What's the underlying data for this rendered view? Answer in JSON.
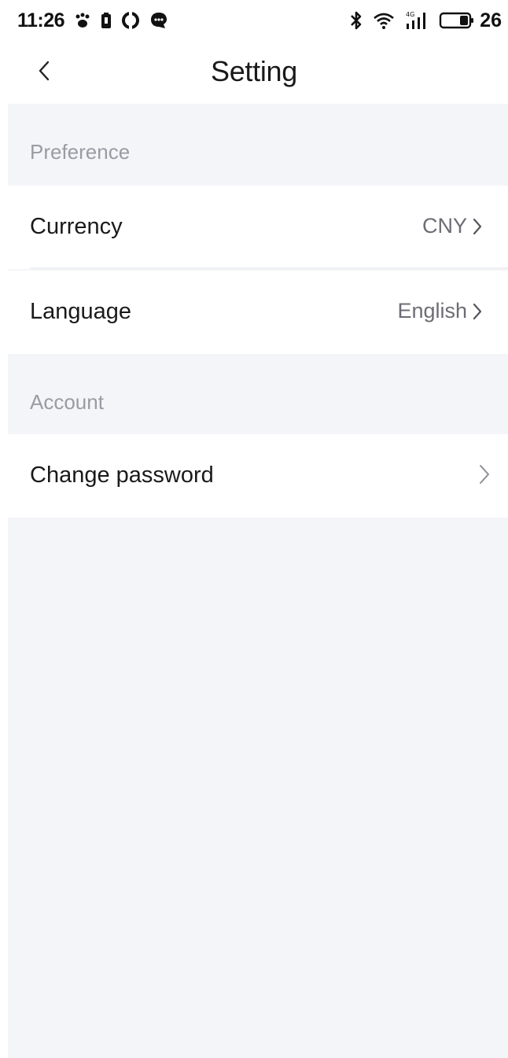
{
  "status_bar": {
    "time": "11:26",
    "battery_level": "26",
    "network_label": "4G",
    "icons": [
      "paw-icon",
      "battery-saver-icon",
      "sync-icon",
      "chat-icon",
      "bluetooth-icon",
      "wifi-icon",
      "signal-4g-icon",
      "battery-icon"
    ]
  },
  "header": {
    "title": "Setting",
    "back_icon": "chevron-left-icon"
  },
  "sections": {
    "preference": {
      "title": "Preference",
      "currency": {
        "label": "Currency",
        "value": "CNY"
      },
      "language": {
        "label": "Language",
        "value": "English"
      }
    },
    "account": {
      "title": "Account",
      "change_password": {
        "label": "Change password"
      }
    }
  },
  "colors": {
    "background": "#f4f5f9",
    "row_background": "#ffffff",
    "text_primary": "#1a1a1a",
    "text_secondary": "#6c6d74",
    "section_title": "#9a9ba3"
  }
}
